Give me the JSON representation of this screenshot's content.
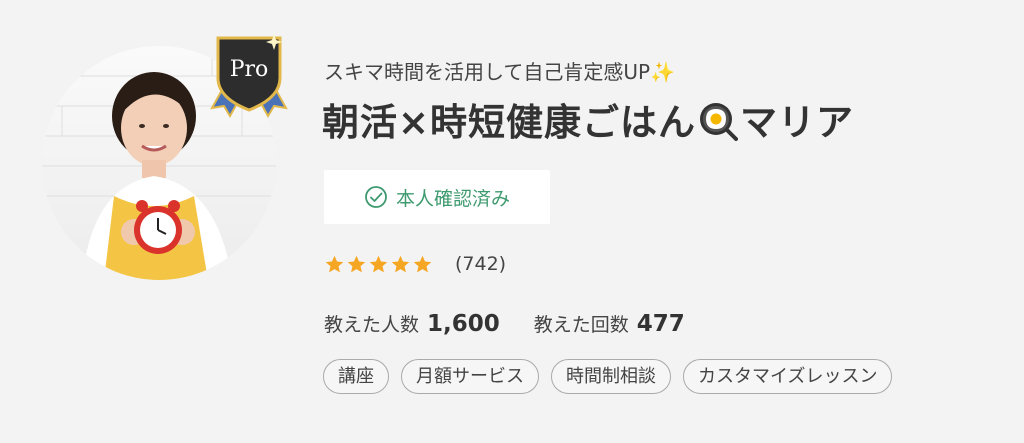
{
  "profile": {
    "tagline": "スキマ時間を活用して自己肯定感UP✨",
    "name_part1": "朝活×時短健康ごはん",
    "name_part2": "マリア",
    "pro_label": "Pro",
    "verified_label": "本人確認済み",
    "rating_stars": 5,
    "rating_count": "(742)",
    "taught_people_label": "教えた人数",
    "taught_people_value": "1,600",
    "taught_times_label": "教えた回数",
    "taught_times_value": "477"
  },
  "tags": [
    "講座",
    "月額サービス",
    "時間制相談",
    "カスタマイズレッスン"
  ],
  "colors": {
    "background": "#f3f3f3",
    "verified_green": "#3e9a6f",
    "star": "#f5a623",
    "badge_dark": "#2d2d2d",
    "badge_ribbon": "#4a72b8"
  },
  "icons": {
    "verified": "check-circle-icon",
    "star": "star-icon",
    "pan": "frying-pan-egg-icon",
    "pro": "pro-shield-icon"
  }
}
